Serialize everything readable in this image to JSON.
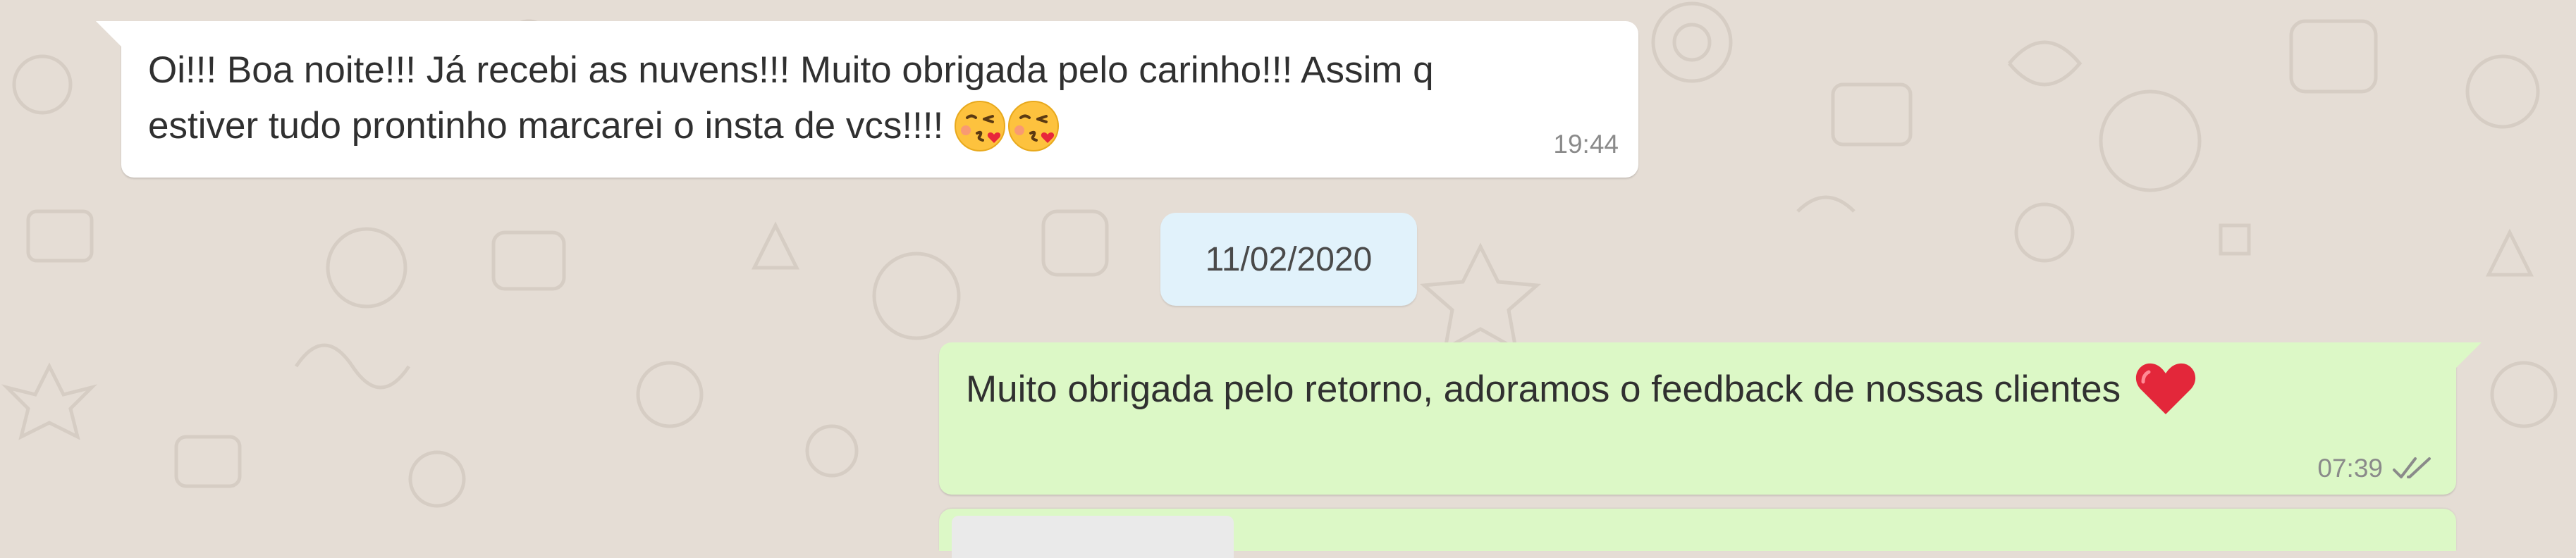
{
  "colors": {
    "wallpaper": "#e5ddd5",
    "incoming_bubble": "#ffffff",
    "outgoing_bubble": "#dcf8c6",
    "date_pill": "#e1f2fb",
    "read_ticks": "#8a8a8a"
  },
  "messages": [
    {
      "direction": "incoming",
      "line1": "Oi!!! Boa noite!!! Já recebi as nuvens!!! Muito obrigada pelo carinho!!! Assim q",
      "line2": "estiver tudo prontinho marcarei o insta de vcs!!!!",
      "emojis": [
        "kiss-emoji",
        "kiss-emoji"
      ],
      "time": "19:44"
    },
    {
      "direction": "outgoing",
      "text": "Muito obrigada pelo retorno, adoramos o feedback de nossas clientes",
      "emojis": [
        "heart-emoji"
      ],
      "time": "07:39",
      "status_icon": "double-check-icon"
    }
  ],
  "date_separator": "11/02/2020"
}
